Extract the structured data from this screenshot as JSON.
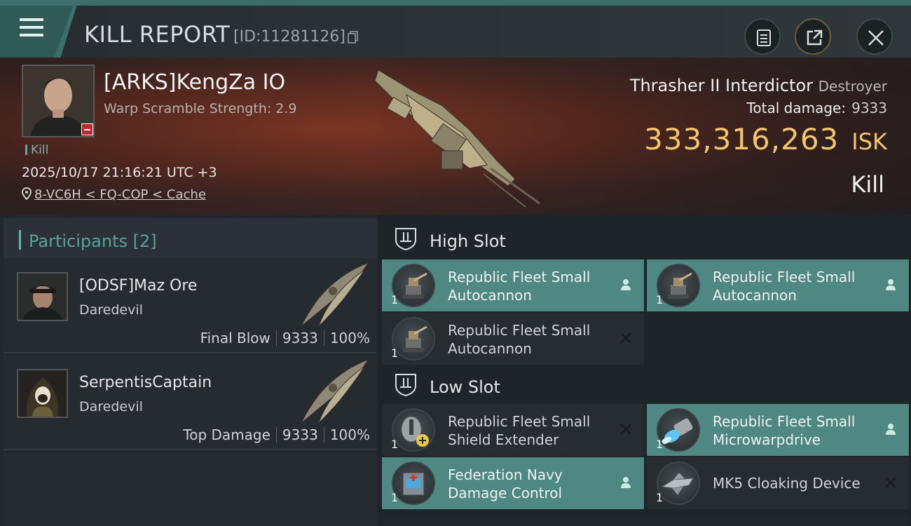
{
  "header": {
    "title": "KILL REPORT",
    "report_id": "[ID:11281126]",
    "menu_icon": "hamburger-menu-icon",
    "buttons": [
      {
        "name": "clipboard-button",
        "icon": "clipboard-icon"
      },
      {
        "name": "export-button",
        "icon": "external-link-icon"
      },
      {
        "name": "close-button",
        "icon": "close-icon"
      }
    ]
  },
  "victim": {
    "pilot": "[ARKS]KengZa IO",
    "warp_scramble": "Warp Scramble Strength: 2.9",
    "tag": "Kill",
    "datetime": "2025/10/17 21:16:21 UTC +3",
    "location": "8-VC6H < FQ-COP < Cache",
    "ship_name": "Thrasher II Interdictor",
    "ship_class": "Destroyer",
    "total_damage_label": "Total damage:",
    "total_damage": "9333",
    "isk_value": "333,316,263",
    "isk_unit": "ISK",
    "result": "Kill"
  },
  "participants": {
    "title": "Participants",
    "count": "[2]",
    "items": [
      {
        "name": "[ODSF]Maz Ore",
        "ship": "Daredevil",
        "role": "Final Blow",
        "damage": "9333",
        "percent": "100%"
      },
      {
        "name": "SerpentisCaptain",
        "ship": "Daredevil",
        "role": "Top Damage",
        "damage": "9333",
        "percent": "100%"
      }
    ]
  },
  "slots": {
    "high": {
      "title": "High Slot",
      "modules": [
        {
          "line1": "Republic Fleet Small",
          "line2": "Autocannon",
          "qty": "1",
          "status": "fitted"
        },
        {
          "line1": "Republic Fleet Small",
          "line2": "Autocannon",
          "qty": "1",
          "status": "fitted"
        },
        {
          "line1": "Republic Fleet Small",
          "line2": "Autocannon",
          "qty": "1",
          "status": "destroyed"
        }
      ]
    },
    "low": {
      "title": "Low Slot",
      "modules": [
        {
          "line1": "Republic Fleet Small",
          "line2": "Shield Extender",
          "qty": "1",
          "status": "destroyed"
        },
        {
          "line1": "Republic Fleet Small",
          "line2": "Microwarpdrive",
          "qty": "1",
          "status": "fitted"
        },
        {
          "line1": "Federation Navy",
          "line2": "Damage Control",
          "qty": "1",
          "status": "fitted"
        },
        {
          "line1": "MK5 Cloaking Device",
          "line2": "",
          "qty": "1",
          "status": "destroyed"
        }
      ]
    }
  },
  "colors": {
    "accent_teal": "#4f8883",
    "isk_gold": "#f2c46c",
    "banner_red": "#7c3524"
  }
}
